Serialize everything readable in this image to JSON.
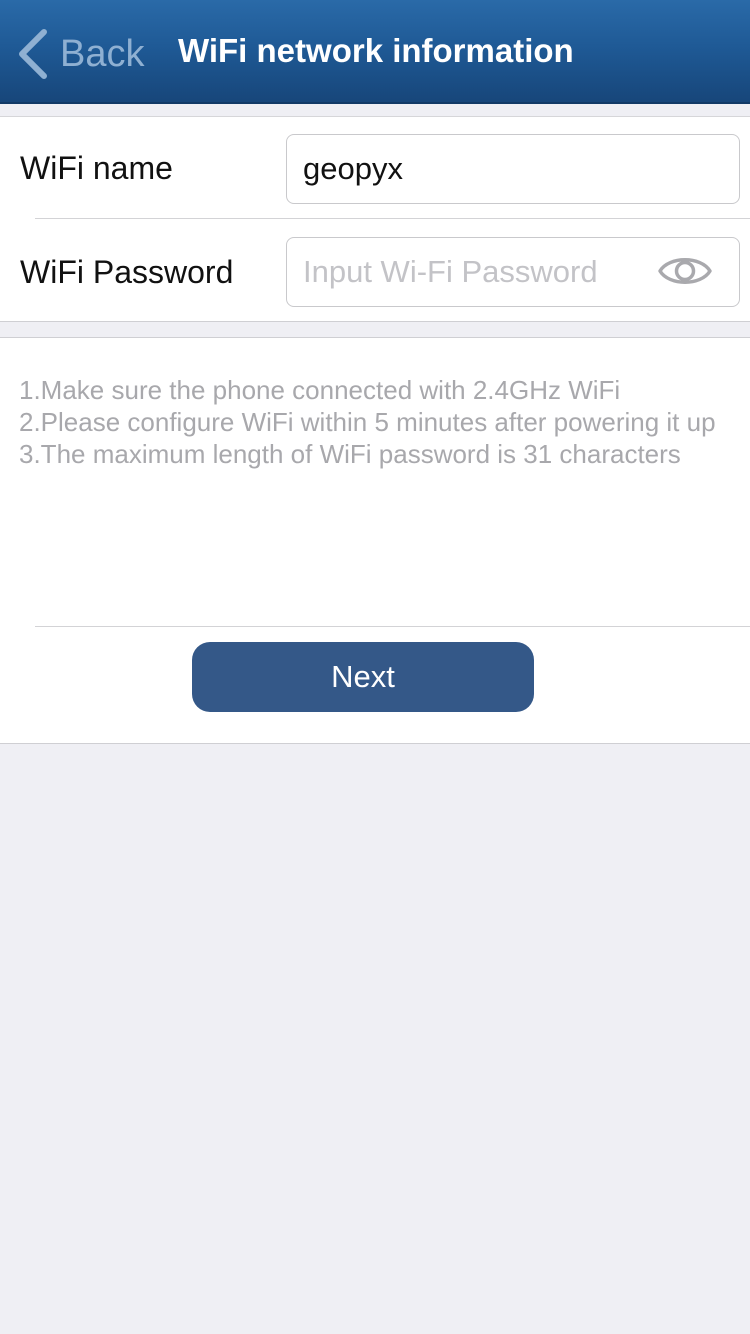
{
  "nav": {
    "back_label": "Back",
    "title": "WiFi network information",
    "bar_color": "#1f5a96"
  },
  "form": {
    "wifi_name_label": "WiFi name",
    "wifi_name_value": "geopyx",
    "wifi_password_label": "WiFi Password",
    "wifi_password_placeholder": "Input Wi-Fi Password",
    "wifi_password_value": "",
    "visibility_icon": "eye-icon"
  },
  "tips": [
    "1.Make sure the phone connected with 2.4GHz WiFi",
    "2.Please configure WiFi within 5 minutes after powering it up",
    "3.The maximum length of WiFi password is 31 characters"
  ],
  "actions": {
    "next_label": "Next",
    "next_color": "#345888"
  }
}
